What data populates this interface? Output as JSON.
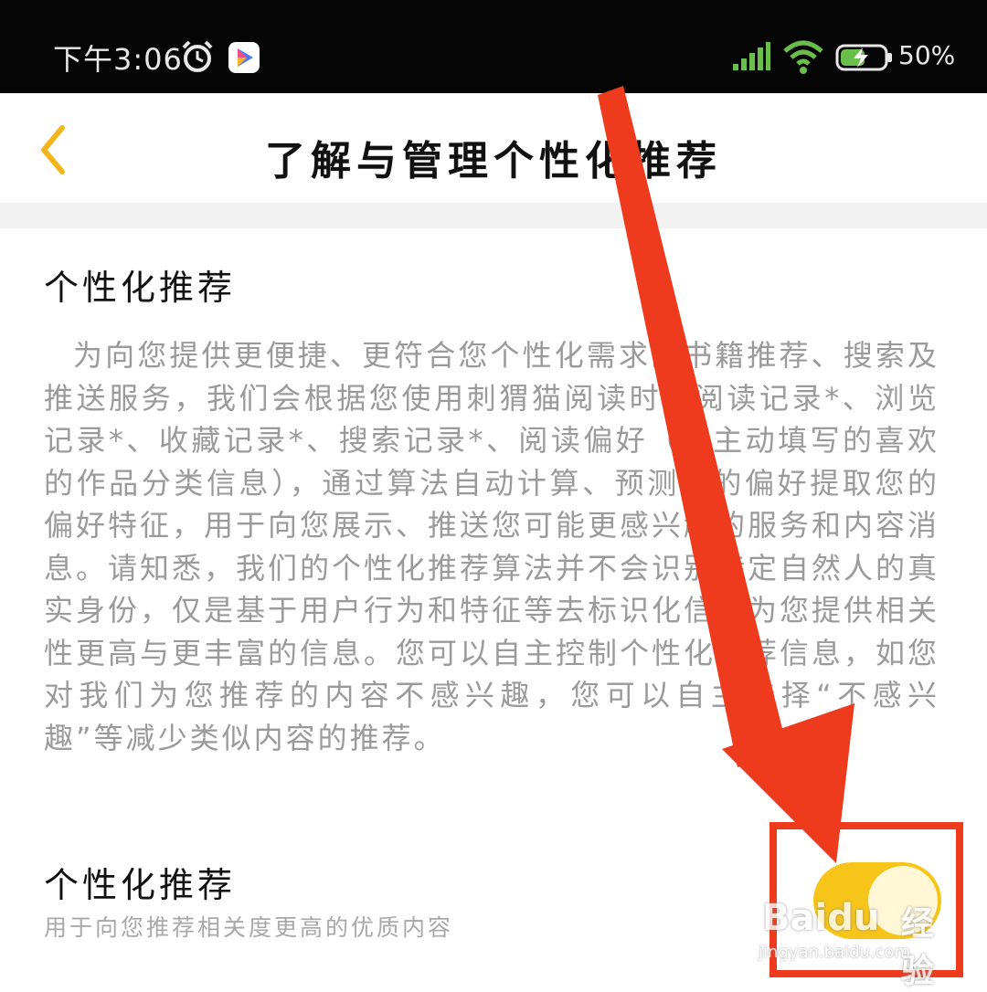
{
  "status_bar": {
    "time": "下午3:06",
    "battery": "50%",
    "icons": [
      "alarm-icon",
      "app-icon",
      "signal-icon",
      "wifi-icon",
      "battery-icon"
    ]
  },
  "nav": {
    "title": "了解与管理个性化推荐",
    "back_icon": "chevron-left-icon"
  },
  "section": {
    "title": "个性化推荐",
    "body": "为向您提供更便捷、更符合您个性化需求的书籍推荐、搜索及推送服务，我们会根据您使用刺猬猫阅读时的阅读记录*、浏览记录*、收藏记录*、搜索记录*、阅读偏好（您主动填写的喜欢的作品分类信息），通过算法自动计算、预测您的偏好提取您的偏好特征，用于向您展示、推送您可能更感兴趣的服务和内容消息。请知悉，我们的个性化推荐算法并不会识别特定自然人的真实身份，仅是基于用户行为和特征等去标识化信息为您提供相关性更高与更丰富的信息。您可以自主控制个性化推荐信息，如您对我们为您推荐的内容不感兴趣，您可以自主选择“不感兴趣”等减少类似内容的推荐。"
  },
  "setting": {
    "title": "个性化推荐",
    "subtitle": "用于向您推荐相关度更高的优质内容",
    "toggle_on": true
  },
  "colors": {
    "accent": "#f7c51a",
    "annotation_red": "#ee3b1e",
    "status_green": "#6abf4b"
  },
  "watermark": {
    "brand": "Baidu",
    "label": "经验",
    "url": "jingyan.baidu.com"
  }
}
